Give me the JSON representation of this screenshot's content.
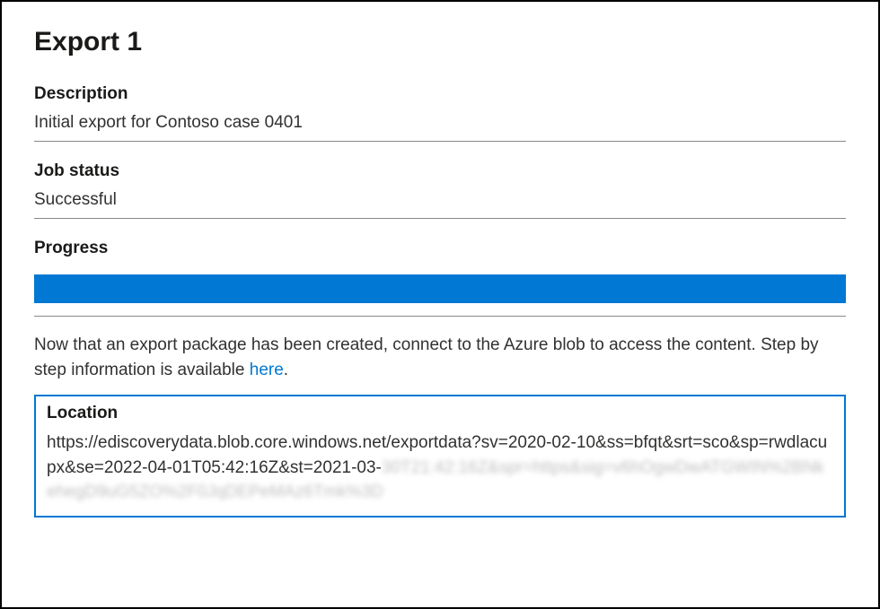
{
  "title": "Export 1",
  "description": {
    "label": "Description",
    "value": "Initial export for Contoso case 0401"
  },
  "jobStatus": {
    "label": "Job status",
    "value": "Successful"
  },
  "progress": {
    "label": "Progress",
    "percent": 100,
    "barColor": "#0078d4"
  },
  "info": {
    "textBefore": "Now that an export package has been created, connect to the Azure blob to access the content. Step by step information is available ",
    "linkText": "here",
    "textAfter": "."
  },
  "location": {
    "label": "Location",
    "urlVisible": "https://ediscoverydata.blob.core.windows.net/exportdata?sv=2020-02-10&ss=bfqt&srt=sco&sp=rwdlacupx&se=2022-04-01T05:42:16Z&st=2021-03-",
    "urlBlurred": "30T21:42:16Z&spr=https&sig=v6hOgwDwATGWIN%2BNkehegD9uG5ZO%2F0JqDEPeMAz6Tmk%3D"
  }
}
